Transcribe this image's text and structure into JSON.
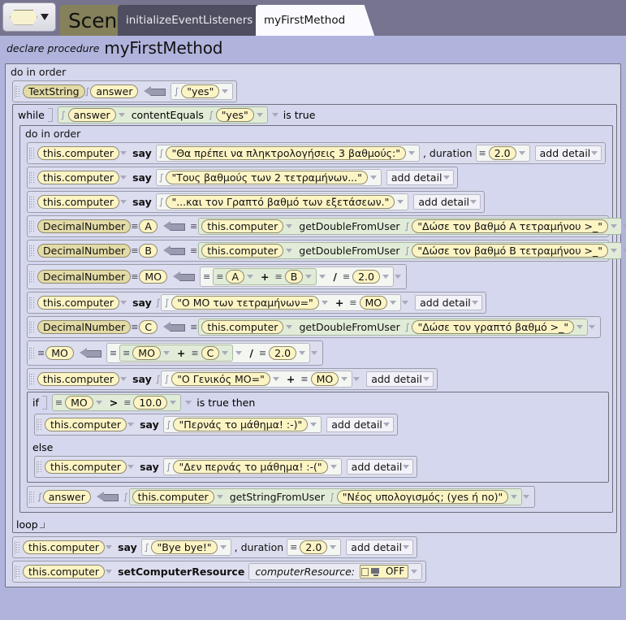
{
  "window": {
    "scene_picker_icon": "hexagon-shape-icon",
    "dropdown_icon": "chevron-down-icon"
  },
  "tabs": [
    {
      "label": "Scene",
      "state": "scene",
      "name": "tab-scene"
    },
    {
      "label": "initializeEventListeners",
      "state": "inactive",
      "name": "tab-initialize-event-listeners"
    },
    {
      "label": "myFirstMethod",
      "state": "active",
      "name": "tab-my-first-method"
    }
  ],
  "header": {
    "declare_keyword": "declare procedure",
    "method_name": "myFirstMethod"
  },
  "labels": {
    "do_in_order": "do in order",
    "while": "while",
    "is_true": "is true",
    "is_true_then": "is true then",
    "if": "if",
    "else": "else",
    "loop": "loop",
    "add_detail": "add detail",
    "say": "say",
    "duration": ", duration",
    "this_computer": "this.computer",
    "content_equals": "contentEquals",
    "get_double_from_user": "getDoubleFromUser",
    "get_string_from_user": "getStringFromUser",
    "set_computer_resource": "setComputerResource",
    "computer_resource_param": "computerResource:",
    "decimal_number": "DecimalNumber",
    "text_string": "TextString",
    "plus": "+",
    "divide": "/",
    "greater_than": ">"
  },
  "code": {
    "answer_init": {
      "type_label": "TextString",
      "var": "answer",
      "value": "\"yes\""
    },
    "while_cond": {
      "var": "answer",
      "method": "contentEquals",
      "arg": "\"yes\""
    },
    "say1": {
      "target": "this.computer",
      "text": "\"Θα πρέπει να πληκτρολογήσεις 3 βαθμούς:\"",
      "duration": "2.0"
    },
    "say2": {
      "target": "this.computer",
      "text": "\"Τους βαθμούς των 2 τετραμήνων...\""
    },
    "say3": {
      "target": "this.computer",
      "text": "\"...και τον Γραπτό βαθμό των εξετάσεων.\""
    },
    "assign_a": {
      "type_label": "DecimalNumber",
      "var": "A",
      "target": "this.computer",
      "method": "getDoubleFromUser",
      "prompt": "\"Δώσε τον βαθμό Α τετραμήνου >_\""
    },
    "assign_b": {
      "type_label": "DecimalNumber",
      "var": "B",
      "target": "this.computer",
      "method": "getDoubleFromUser",
      "prompt": "\"Δώσε τον βαθμό Β τετραμήνου >_\""
    },
    "assign_mo": {
      "type_label": "DecimalNumber",
      "var": "MO",
      "op1": "A",
      "operator": "+",
      "op2": "B",
      "divider": "/",
      "divisor": "2.0"
    },
    "say_mo": {
      "target": "this.computer",
      "text": "\"Ο ΜΟ των τετραμήνων=\"",
      "concat": "+",
      "var": "MO"
    },
    "assign_c": {
      "type_label": "DecimalNumber",
      "var": "C",
      "target": "this.computer",
      "method": "getDoubleFromUser",
      "prompt": "\"Δώσε τον γραπτό βαθμό >_\""
    },
    "assign_mo2": {
      "var": "MO",
      "op1": "MO",
      "operator": "+",
      "op2": "C",
      "divider": "/",
      "divisor": "2.0"
    },
    "say_general_mo": {
      "target": "this.computer",
      "text": "\"Ο Γενικός ΜΟ=\"",
      "concat": "+",
      "var": "MO"
    },
    "if_cond": {
      "left": "MO",
      "operator": ">",
      "right": "10.0"
    },
    "say_pass": {
      "target": "this.computer",
      "text": "\"Περνάς το μάθημα! :-)\""
    },
    "say_fail": {
      "target": "this.computer",
      "text": "\"Δεν περνάς το μάθημα! :-(\""
    },
    "answer_reassign": {
      "var": "answer",
      "target": "this.computer",
      "method": "getStringFromUser",
      "prompt": "\"Νέος υπολογισμός; (yes ή no)\""
    },
    "say_bye": {
      "target": "this.computer",
      "text": "\"Bye bye!\"",
      "duration": "2.0"
    },
    "set_resource": {
      "target": "this.computer",
      "method": "setComputerResource",
      "param_label": "computerResource:",
      "value": "OFF"
    }
  },
  "colors": {
    "window_bg": "#777490",
    "canvas_bg": "#b0b4dd",
    "block_bg": "#d4d7ed",
    "statement_bg": "#dcdeef",
    "pill_yellow": "#fdf4c4",
    "pill_tan": "#e3dba6",
    "expr_green": "#e1ecd8",
    "tab_active": "#fbfbff",
    "tab_inactive": "#4f4e60",
    "tab_scene": "#85815b"
  }
}
